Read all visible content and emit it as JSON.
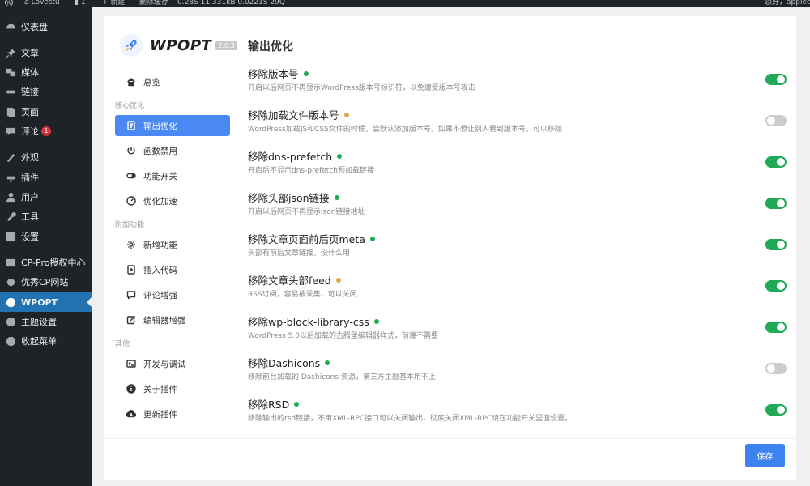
{
  "adminbar": {
    "site_name": "Lovestu",
    "comments_count": "1",
    "new_label": "新建",
    "clear_cache": "删除缓存",
    "stats": "0.28S   11,331kB   0.0221S   29Q",
    "greeting": "您好，applec"
  },
  "sidebar": {
    "items": [
      {
        "label": "仪表盘",
        "icon": "dashboard-icon"
      },
      {
        "label": "文章",
        "icon": "pin-icon"
      },
      {
        "label": "媒体",
        "icon": "media-icon"
      },
      {
        "label": "链接",
        "icon": "link-icon"
      },
      {
        "label": "页面",
        "icon": "page-icon"
      },
      {
        "label": "评论",
        "icon": "comment-icon",
        "badge": "1"
      },
      {
        "label": "外观",
        "icon": "appearance-icon"
      },
      {
        "label": "插件",
        "icon": "plugin-icon"
      },
      {
        "label": "用户",
        "icon": "user-icon"
      },
      {
        "label": "工具",
        "icon": "wrench-icon"
      },
      {
        "label": "设置",
        "icon": "settings-icon"
      },
      {
        "label": "CP-Pro授权中心",
        "icon": "cp-icon"
      },
      {
        "label": "优秀CP网站",
        "icon": "gear-icon"
      },
      {
        "label": "WPOPT",
        "icon": "wpopt-icon",
        "current": true
      },
      {
        "label": "主题设置",
        "icon": "theme-icon"
      },
      {
        "label": "收起菜单",
        "icon": "collapse-icon"
      }
    ]
  },
  "plugin": {
    "name": "WPOPT",
    "version": "2.0.3",
    "nav": {
      "overview": "总览",
      "group_core": "核心优化",
      "output": "输出优化",
      "disable_funcs": "函数禁用",
      "feature_switch": "功能开关",
      "speedup": "优化加速",
      "group_extra": "附加功能",
      "new_features": "新增功能",
      "insert_code": "插入代码",
      "comment_enhance": "评论增强",
      "editor_enhance": "编辑器增强",
      "group_other": "其他",
      "dev_debug": "开发与调试",
      "about": "关于插件",
      "update": "更新插件"
    }
  },
  "content": {
    "title": "输出优化",
    "save_label": "保存",
    "status_colors": {
      "green": "#1faa56",
      "orange": "#dea545"
    },
    "options": [
      {
        "title": "移除版本号",
        "dot": "green",
        "desc": "开启以后网页不再显示WordPress版本号标识符，以免遭受版本号攻击",
        "enabled": true
      },
      {
        "title": "移除加载文件版本号",
        "dot": "orange",
        "desc": "WordPress加载JS和CSS文件的时候，会默认添加版本号，如果不想让别人看到版本号，可以移除",
        "enabled": false
      },
      {
        "title": "移除dns-prefetch",
        "dot": "green",
        "desc": "开启后不显示dns-prefetch预加载链接",
        "enabled": true
      },
      {
        "title": "移除头部json链接",
        "dot": "green",
        "desc": "开启以后网页不再显示json链接地址",
        "enabled": true
      },
      {
        "title": "移除文章页面前后页meta",
        "dot": "green",
        "desc": "头部有前后文章链接，没什么用",
        "enabled": true
      },
      {
        "title": "移除文章头部feed",
        "dot": "orange",
        "desc": "RSS订阅，容易被采集，可以关闭",
        "enabled": true
      },
      {
        "title": "移除wp-block-library-css",
        "dot": "green",
        "desc": "WordPress 5.0以后加载的古腾堡编辑器样式，前端不需要",
        "enabled": true
      },
      {
        "title": "移除Dashicons",
        "dot": "green",
        "desc": "移除前台加载的 Dashicons 资源，第三方主题基本用不上",
        "enabled": false
      },
      {
        "title": "移除RSD",
        "dot": "green",
        "desc": "移除输出的rsd链接，不用XML-RPC接口可以关闭输出。彻底关闭XML-RPC请在功能开关里面设置。",
        "enabled": true
      }
    ]
  }
}
